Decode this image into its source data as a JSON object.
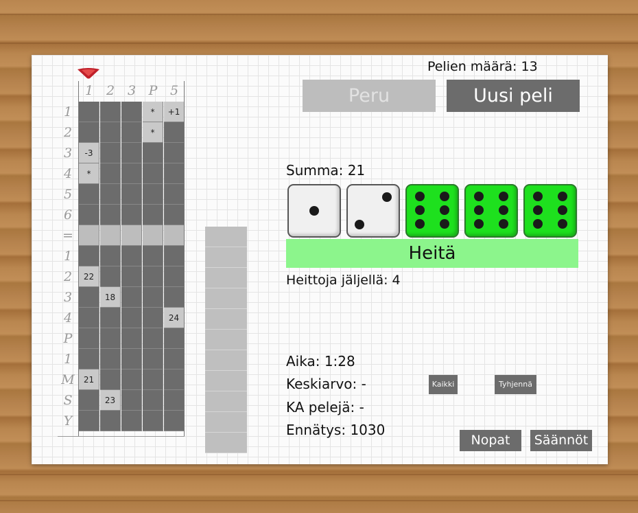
{
  "header": {
    "games_count_label": "Pelien määrä: 13"
  },
  "buttons": {
    "undo": "Peru",
    "new_game": "Uusi peli",
    "roll": "Heitä",
    "select_all": "Kaikki",
    "clear": "Tyhjennä",
    "dice": "Nopat",
    "rules": "Säännöt"
  },
  "dice_panel": {
    "sum_label": "Summa: 21",
    "throws_left_label": "Heittoja jäljellä: 4",
    "dice": [
      {
        "value": 1,
        "held": false
      },
      {
        "value": 2,
        "held": false
      },
      {
        "value": 6,
        "held": true
      },
      {
        "value": 6,
        "held": true
      },
      {
        "value": 6,
        "held": true
      }
    ],
    "colors": {
      "held": "#1ee01e",
      "free": "#f0f0f0",
      "roll_button": "#8cf58c"
    }
  },
  "stats": {
    "time": "Aika: 1:28",
    "average": "Keskiarvo: -",
    "avg_games": "KA pelejä: -",
    "record": "Ennätys: 1030"
  },
  "scoreboard": {
    "column_headers": [
      "1",
      "2",
      "3",
      "P",
      "5"
    ],
    "row_labels": [
      "1",
      "2",
      "3",
      "4",
      "5",
      "6",
      "=",
      "1",
      "2",
      "3",
      "4",
      "P",
      "1",
      "M",
      "S",
      "Y"
    ],
    "cells": [
      [
        "",
        "",
        "",
        "*",
        "+1"
      ],
      [
        "",
        "",
        "",
        "*",
        ""
      ],
      [
        "-3",
        "",
        "",
        "",
        ""
      ],
      [
        "*",
        "",
        "",
        "",
        ""
      ],
      [
        "",
        "",
        "",
        "",
        ""
      ],
      [
        "",
        "",
        "",
        "",
        ""
      ],
      [
        "",
        "",
        "",
        "",
        ""
      ],
      [
        "",
        "",
        "",
        "",
        ""
      ],
      [
        "22",
        "",
        "",
        "",
        ""
      ],
      [
        "",
        "18",
        "",
        "",
        ""
      ],
      [
        "",
        "",
        "",
        "",
        "24"
      ],
      [
        "",
        "",
        "",
        "",
        ""
      ],
      [
        "",
        "",
        "",
        "",
        ""
      ],
      [
        "21",
        "",
        "",
        "",
        ""
      ],
      [
        "",
        "23",
        "",
        "",
        ""
      ],
      [
        "",
        "",
        "",
        "",
        ""
      ]
    ],
    "filled": [
      [
        false,
        false,
        false,
        true,
        true
      ],
      [
        false,
        false,
        false,
        true,
        false
      ],
      [
        true,
        false,
        false,
        false,
        false
      ],
      [
        true,
        false,
        false,
        false,
        false
      ],
      [
        false,
        false,
        false,
        false,
        false
      ],
      [
        false,
        false,
        false,
        false,
        false
      ],
      [
        true,
        true,
        true,
        true,
        true
      ],
      [
        false,
        false,
        false,
        false,
        false
      ],
      [
        true,
        false,
        false,
        false,
        false
      ],
      [
        false,
        true,
        false,
        false,
        false
      ],
      [
        false,
        false,
        false,
        false,
        true
      ],
      [
        false,
        false,
        false,
        false,
        false
      ],
      [
        false,
        false,
        false,
        false,
        false
      ],
      [
        true,
        false,
        false,
        false,
        false
      ],
      [
        false,
        true,
        false,
        false,
        false
      ],
      [
        false,
        false,
        false,
        false,
        false
      ]
    ],
    "totals_rows": 11
  }
}
